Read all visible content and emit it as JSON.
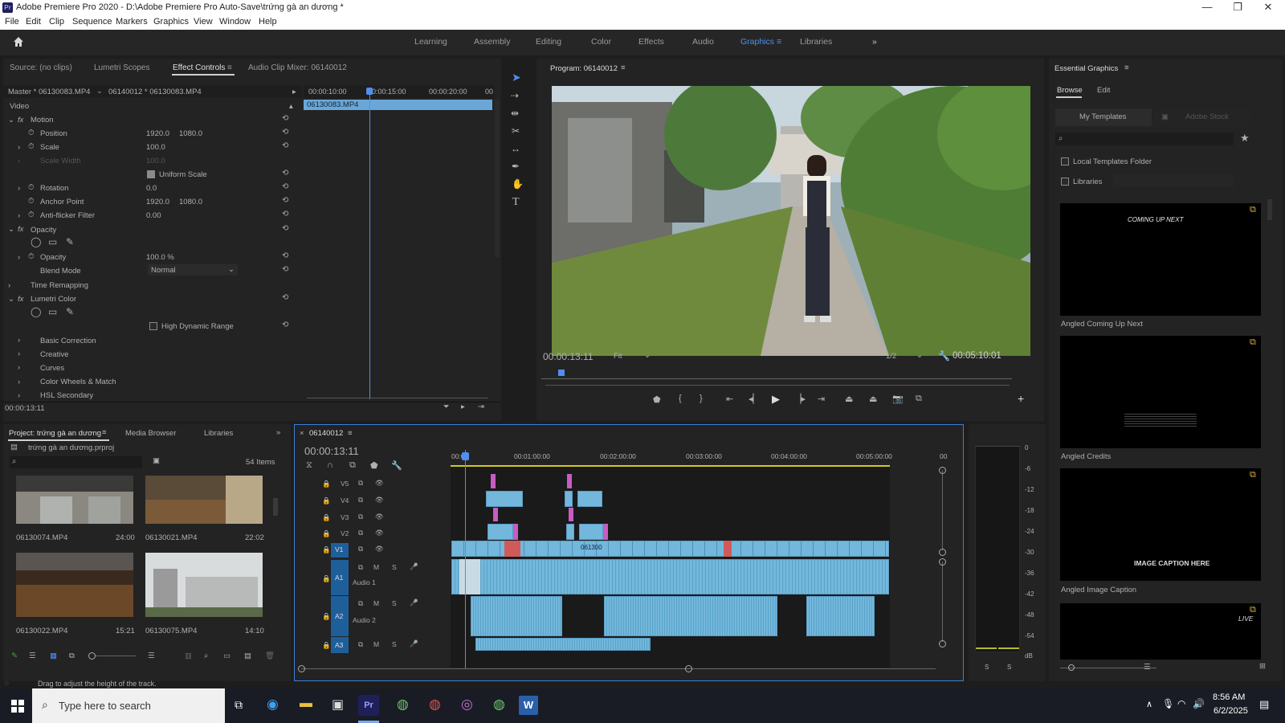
{
  "window": {
    "title": "Adobe Premiere Pro 2020 - D:\\Adobe Premiere Pro Auto-Save\\trứng gà an dương *"
  },
  "menu": [
    "File",
    "Edit",
    "Clip",
    "Sequence",
    "Markers",
    "Graphics",
    "View",
    "Window",
    "Help"
  ],
  "workspaces": {
    "items": [
      "Learning",
      "Assembly",
      "Editing",
      "Color",
      "Effects",
      "Audio",
      "Graphics",
      "Libraries"
    ],
    "active": "Graphics"
  },
  "effect_controls": {
    "tabs": [
      "Source: (no clips)",
      "Lumetri Scopes",
      "Effect Controls",
      "Audio Clip Mixer: 06140012"
    ],
    "master": "Master * 06130083.MP4",
    "clip": "06140012 * 06130083.MP4",
    "section_video": "Video",
    "motion": "Motion",
    "position_label": "Position",
    "position_x": "1920.0",
    "position_y": "1080.0",
    "scale_label": "Scale",
    "scale_value": "100.0",
    "scale_width_label": "Scale Width",
    "scale_width_value": "100.0",
    "uniform_scale": "Uniform Scale",
    "rotation_label": "Rotation",
    "rotation_value": "0.0",
    "anchor_label": "Anchor Point",
    "anchor_x": "1920.0",
    "anchor_y": "1080.0",
    "antiflicker_label": "Anti-flicker Filter",
    "antiflicker_value": "0.00",
    "opacity_section": "Opacity",
    "opacity_label": "Opacity",
    "opacity_value": "100.0 %",
    "blend_label": "Blend Mode",
    "blend_value": "Normal",
    "time_remap": "Time Remapping",
    "lumetri": "Lumetri Color",
    "hdr": "High Dynamic Range",
    "basic": "Basic Correction",
    "creative": "Creative",
    "curves": "Curves",
    "wheels": "Color Wheels & Match",
    "hsl": "HSL Secondary",
    "timecode": "00:00:13:11",
    "mini_ruler": [
      "00:00:10:00",
      "00:00:15:00",
      "00:00:20:00",
      "00"
    ],
    "mini_clip": "06130083.MP4"
  },
  "program": {
    "title": "Program: 06140012",
    "timecode": "00:00:13:11",
    "fit": "Fit",
    "resolution": "1/2",
    "duration": "00:05:10:01"
  },
  "essential_graphics": {
    "title": "Essential Graphics",
    "tabs": [
      "Browse",
      "Edit"
    ],
    "sources": [
      "My Templates",
      "Adobe Stock"
    ],
    "local_templates": "Local Templates Folder",
    "libraries": "Libraries",
    "templates": [
      {
        "name": "Angled Coming Up Next",
        "preview_text": "COMING UP NEXT"
      },
      {
        "name": "Angled Credits",
        "preview_text": ""
      },
      {
        "name": "Angled Image Caption",
        "preview_text": "IMAGE CAPTION HERE"
      },
      {
        "name": "",
        "preview_text": "LIVE"
      }
    ]
  },
  "project": {
    "tabs": [
      "Project: trứng gà an dương",
      "Media Browser",
      "Libraries"
    ],
    "file": "trứng gà an dương.prproj",
    "count": "54 Items",
    "items": [
      {
        "name": "06130074.MP4",
        "duration": "24:00"
      },
      {
        "name": "06130021.MP4",
        "duration": "22:02"
      },
      {
        "name": "06130022.MP4",
        "duration": "15:21"
      },
      {
        "name": "06130075.MP4",
        "duration": "14:10"
      }
    ]
  },
  "timeline": {
    "sequence": "06140012",
    "timecode": "00:00:13:11",
    "ruler": [
      "00:00",
      "00:01:00:00",
      "00:02:00:00",
      "00:03:00:00",
      "00:04:00:00",
      "00:05:00:00",
      "00"
    ],
    "video_tracks": [
      "V5",
      "V4",
      "V3",
      "V2",
      "V1"
    ],
    "audio_tracks": [
      {
        "id": "A1",
        "name": "Audio 1"
      },
      {
        "id": "A2",
        "name": "Audio 2"
      },
      {
        "id": "A3",
        "name": ""
      }
    ],
    "v1_clip": "061300"
  },
  "meter": {
    "scale": [
      "0",
      "-6",
      "-12",
      "-18",
      "-24",
      "-30",
      "-36",
      "-42",
      "-48",
      "-54",
      "dB"
    ],
    "solo": [
      "S",
      "S"
    ]
  },
  "status": "Drag to adjust the height of the track.",
  "taskbar": {
    "search_placeholder": "Type here to search",
    "time": "8:56 AM",
    "date": "6/2/2025"
  }
}
